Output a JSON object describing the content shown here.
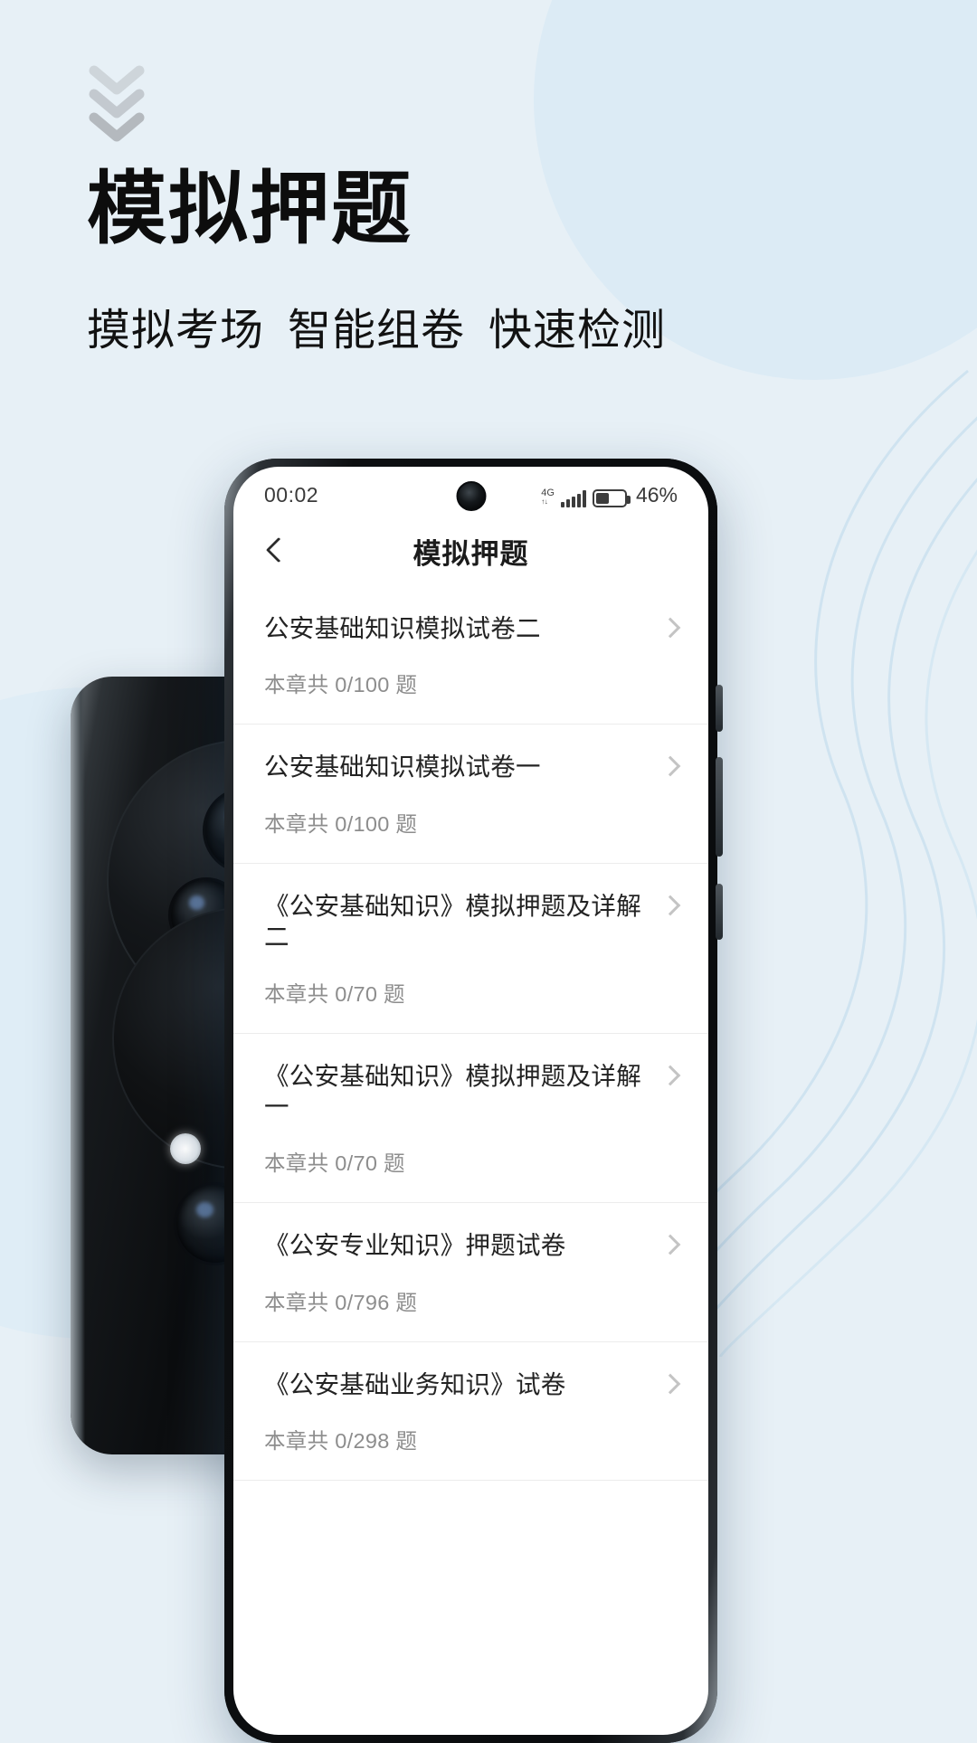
{
  "promo": {
    "title": "模拟押题",
    "subtitle_parts": [
      "摸拟考场",
      "智能组卷",
      "快速检测"
    ],
    "chevron_icon": "chevron-down-icon",
    "bg_color": "#e7f0f6",
    "title_color": "#0d0d0d"
  },
  "phone": {
    "statusbar": {
      "time": "00:02",
      "network": "4G",
      "network_sub": "↑↓",
      "battery_percent": "46%",
      "signal_icon": "signal-bars-icon",
      "battery_icon": "battery-icon",
      "camera_icon": "front-camera-punch-hole"
    },
    "navbar": {
      "back_icon": "chevron-left-icon",
      "title": "模拟押题"
    },
    "list": {
      "chevron_icon": "chevron-right-icon",
      "items": [
        {
          "title": "公安基础知识模拟试卷二",
          "sub_prefix": "本章共",
          "count": "0/100",
          "sub_suffix": "题"
        },
        {
          "title": "公安基础知识模拟试卷一",
          "sub_prefix": "本章共",
          "count": "0/100",
          "sub_suffix": "题"
        },
        {
          "title": "《公安基础知识》模拟押题及详解二",
          "sub_prefix": "本章共",
          "count": "0/70",
          "sub_suffix": "题"
        },
        {
          "title": "《公安基础知识》模拟押题及详解一",
          "sub_prefix": "本章共",
          "count": "0/70",
          "sub_suffix": "题"
        },
        {
          "title": "《公安专业知识》押题试卷",
          "sub_prefix": "本章共",
          "count": "0/796",
          "sub_suffix": "题"
        },
        {
          "title": "《公安基础业务知识》试卷",
          "sub_prefix": "本章共",
          "count": "0/298",
          "sub_suffix": "题"
        }
      ]
    }
  }
}
